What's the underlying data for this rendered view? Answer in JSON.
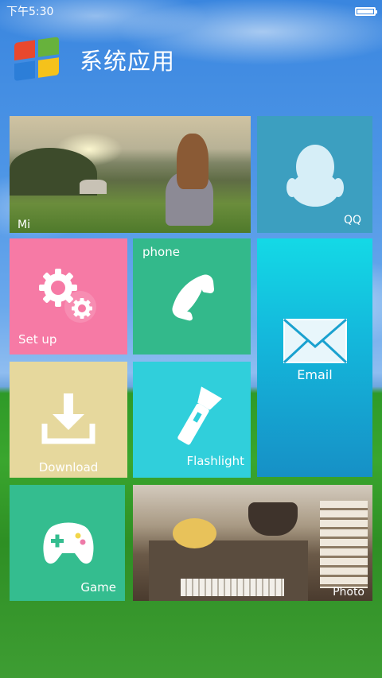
{
  "status_bar": {
    "time": "下午5:30"
  },
  "header": {
    "title": "系统应用"
  },
  "tiles": {
    "mi": {
      "label": "Mi"
    },
    "qq": {
      "label": "QQ"
    },
    "setup": {
      "label": "Set up"
    },
    "phone": {
      "label": "phone"
    },
    "email": {
      "label": "Email"
    },
    "download": {
      "label": "Download"
    },
    "flashlight": {
      "label": "Flashlight"
    },
    "game": {
      "label": "Game"
    },
    "photo": {
      "label": "Photo"
    }
  },
  "icons": {
    "windows_logo": "windows-logo-icon",
    "qq": "qq-penguin-icon",
    "setup": "gear-icon",
    "phone": "phone-handset-icon",
    "email": "envelope-icon",
    "download": "download-tray-icon",
    "flashlight": "flashlight-icon",
    "game": "gamepad-icon",
    "battery": "battery-icon"
  },
  "colors": {
    "qq": "#3c9fc0",
    "setup": "#f67aa5",
    "phone": "#33b98b",
    "email": "#14b9dc",
    "download": "#e6d89d",
    "flashlight": "#30cfdb",
    "game": "#34bd8f"
  }
}
